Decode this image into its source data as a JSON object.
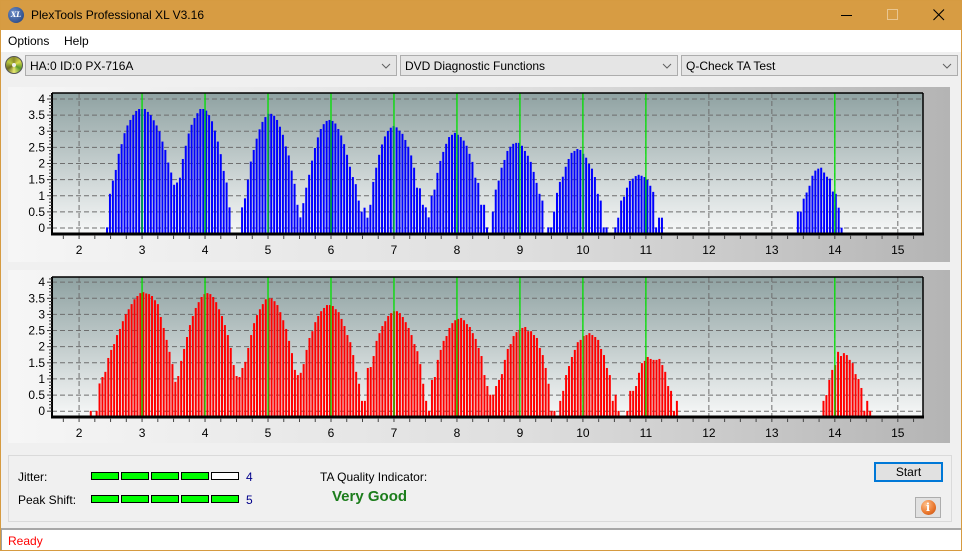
{
  "window": {
    "title": "PlexTools Professional XL V3.16",
    "app_logo_text": "XL",
    "icons": {
      "app": "xl-logo-icon",
      "minimize": "minimize-icon",
      "maximize": "maximize-icon",
      "close": "close-icon"
    },
    "frame_color": "#d79c43"
  },
  "menu": {
    "items": [
      {
        "label": "Options"
      },
      {
        "label": "Help"
      }
    ]
  },
  "toolbar": {
    "drive_icon": "cd-drive-icon",
    "drive_select": {
      "value": "HA:0 ID:0  PX-716A"
    },
    "function_select": {
      "value": "DVD Diagnostic Functions"
    },
    "test_select": {
      "value": "Q-Check TA Test"
    }
  },
  "results": {
    "jitter": {
      "label": "Jitter:",
      "value": "4",
      "level": 4,
      "max": 5
    },
    "peak_shift": {
      "label": "Peak Shift:",
      "value": "5",
      "level": 5,
      "max": 5
    },
    "ta_quality": {
      "label": "TA Quality Indicator:",
      "value": "Very Good",
      "color": "#1c7d1c"
    },
    "meter_on_color": "#00ff00"
  },
  "buttons": {
    "start": "Start",
    "info_icon": "info-icon",
    "info_glyph": "i"
  },
  "status": {
    "text": "Ready",
    "color": "#ff0000"
  },
  "chart_data": [
    {
      "type": "bar",
      "title": "",
      "xlabel": "",
      "ylabel": "",
      "xlim": [
        1.57,
        15.4
      ],
      "ylim": [
        -0.186,
        4.186
      ],
      "xticks": [
        2,
        3,
        4,
        5,
        6,
        7,
        8,
        9,
        10,
        11,
        12,
        13,
        14,
        15
      ],
      "yticks": [
        "0",
        "0.5",
        "1",
        "1.5",
        "2",
        "2.5",
        "3",
        "3.5",
        "4"
      ],
      "grid": true,
      "legend": "none",
      "bar_color": "#0000ff",
      "marker_color": "#00e000",
      "plot_bg": [
        "#8fa2a2",
        "#f7f8f8"
      ],
      "markers": [
        3,
        4,
        5,
        6,
        7,
        8,
        9,
        10,
        11,
        14
      ],
      "bar_step": 0.0463,
      "runs": [
        {
          "start": 2.444,
          "values": [
            0.02,
            1.06,
            1.47,
            1.8,
            2.3,
            2.6,
            2.94,
            3.18,
            3.35,
            3.5,
            3.63,
            3.69,
            3.69,
            3.69,
            3.6,
            3.5,
            3.34,
            3.18,
            3.0,
            2.68,
            2.42,
            2.03,
            1.72,
            1.34,
            1.41,
            1.56,
            2.14,
            2.55,
            2.93,
            3.2,
            3.41,
            3.56,
            3.69,
            3.69,
            3.64,
            3.5,
            3.31,
            3.02,
            2.68,
            2.29,
            1.77,
            1.41,
            0.64
          ]
        },
        {
          "start": 4.588,
          "values": [
            0.64,
            0.92,
            1.5,
            2.06,
            2.42,
            2.77,
            3.06,
            3.29,
            3.44,
            3.54,
            3.54,
            3.48,
            3.35,
            3.14,
            2.89,
            2.53,
            2.25,
            1.78,
            1.37,
            0.72,
            0.33,
            0.77,
            1.25,
            1.65,
            2.09,
            2.48,
            2.81,
            3.07,
            3.22,
            3.32,
            3.35,
            3.32,
            3.24,
            3.07,
            2.87,
            2.6,
            2.27,
            1.9,
            1.58,
            1.36,
            0.85,
            0.51,
            0.63,
            0.32,
            0.72,
            1.43,
            1.87,
            2.27,
            2.59,
            2.84,
            3.01,
            3.11,
            3.16,
            3.12,
            3.02,
            2.92,
            2.73,
            2.52,
            2.25,
            1.87,
            1.25,
            1.23,
            0.72,
            0.64,
            0.33,
            1.0,
            1.19,
            1.71,
            2.08,
            2.36,
            2.61,
            2.82,
            2.89,
            2.95,
            2.89,
            2.82,
            2.71,
            2.55,
            2.3,
            2.05,
            1.56,
            1.4,
            0.72,
            0.72,
            0.02,
            0,
            0.51,
            1.19,
            1.47,
            1.87,
            2.11,
            2.39,
            2.52,
            2.61,
            2.64,
            2.64,
            2.55,
            2.39,
            2.24,
            2.05,
            1.74,
            1.4,
            1.06,
            0.85,
            0,
            0.02,
            0.02,
            0.51,
            1.09,
            1.43,
            1.59,
            1.9,
            2.14,
            2.33,
            2.39,
            2.45,
            2.42,
            2.3,
            2.18,
            1.99,
            1.84,
            1.58,
            1.06,
            0.85,
            0.02,
            0.02,
            0,
            0,
            0.02,
            0.32,
            0.85,
            0.97,
            1.25,
            1.46,
            1.53,
            1.61,
            1.65,
            1.62,
            1.58,
            1.49,
            1.31,
            1.12,
            0.02,
            0.32,
            0.32
          ]
        },
        {
          "start": 13.413,
          "values": [
            0.51,
            0.51,
            0.91,
            1.1,
            1.31,
            1.62,
            1.78,
            1.84,
            1.87,
            1.72,
            1.59,
            1.53,
            1.13,
            1.06,
            0.63,
            0.01
          ]
        }
      ]
    },
    {
      "type": "bar",
      "title": "",
      "xlabel": "",
      "ylabel": "",
      "xlim": [
        1.57,
        15.4
      ],
      "ylim": [
        -0.18,
        4.16
      ],
      "xticks": [
        2,
        3,
        4,
        5,
        6,
        7,
        8,
        9,
        10,
        11,
        12,
        13,
        14,
        15
      ],
      "yticks": [
        "0",
        "0.5",
        "1",
        "1.5",
        "2",
        "2.5",
        "3",
        "3.5",
        "4"
      ],
      "grid": true,
      "legend": "none",
      "bar_color": "#ff0000",
      "marker_color": "#00e000",
      "plot_bg": [
        "#8fa2a2",
        "#f7f8f8"
      ],
      "markers": [
        3,
        4,
        5,
        6,
        7,
        8,
        9,
        10,
        11,
        14
      ],
      "bar_step": 0.0463,
      "runs": [
        {
          "start": 2.186,
          "values": [
            0.01,
            0,
            0.01,
            0.86,
            1.06,
            1.22,
            1.65,
            1.9,
            2.08,
            2.36,
            2.55,
            2.79,
            3.01,
            3.16,
            3.32,
            3.47,
            3.57,
            3.66,
            3.69,
            3.65,
            3.63,
            3.57,
            3.44,
            3.32,
            2.92,
            2.58,
            2.21,
            1.84,
            1.46,
            0.91,
            1.09,
            1.56,
            1.93,
            2.3,
            2.67,
            2.95,
            3.2,
            3.38,
            3.54,
            3.63,
            3.66,
            3.63,
            3.54,
            3.38,
            3.16,
            2.95,
            2.67,
            2.36,
            1.96,
            1.43,
            1.09,
            1.06,
            1.34,
            1.53,
            1.96,
            2.36,
            2.73,
            2.98,
            3.16,
            3.32,
            3.47,
            3.5,
            3.5,
            3.41,
            3.29,
            3.07,
            2.82,
            2.55,
            2.18,
            1.8,
            1.28,
            1.12,
            1.19,
            1.46,
            1.9,
            2.27,
            2.48,
            2.76,
            2.95,
            3.1,
            3.2,
            3.29,
            3.29,
            3.26,
            3.16,
            3.07,
            2.86,
            2.64,
            2.36,
            2.14,
            1.74,
            1.22,
            0.85,
            0.32,
            0.32,
            1.34,
            1.37,
            1.71,
            2.18,
            2.42,
            2.64,
            2.79,
            2.95,
            3.04,
            3.1,
            3.1,
            3.04,
            2.92,
            2.76,
            2.58,
            2.36,
            2.08,
            1.86,
            1.46,
            0.85,
            0.32,
            0.01,
            0.97,
            1.06,
            1.59,
            1.9,
            2.18,
            2.33,
            2.58,
            2.73,
            2.82,
            2.86,
            2.89,
            2.82,
            2.7,
            2.61,
            2.42,
            2.24,
            1.96,
            1.71,
            1.12,
            0.78,
            0.51,
            0.51,
            0.78,
            0.97,
            1.15,
            1.59,
            1.93,
            2.08,
            2.33,
            2.45,
            2.52,
            2.58,
            2.61,
            2.48,
            2.48,
            2.36,
            2.27,
            1.96,
            1.74,
            1.34,
            0.85,
            0.01,
            0.01,
            0,
            0.32,
            0.63,
            1.12,
            1.4,
            1.68,
            1.9,
            2.14,
            2.21,
            2.33,
            2.36,
            2.42,
            2.36,
            2.3,
            2.21,
            1.93,
            1.74,
            1.34,
            1.12,
            0.32,
            0.51,
            0.01,
            0,
            0,
            0.01,
            0.63,
            0.63,
            0.78,
            1.19,
            1.49,
            1.56,
            1.68,
            1.62,
            1.59,
            1.59,
            1.62,
            1.43,
            1.22,
            0.78,
            0.63,
            0.01,
            0.32
          ]
        },
        {
          "start": 13.82,
          "values": [
            0.32,
            0.5,
            0.97,
            1.28,
            1.43,
            1.84,
            1.71,
            1.8,
            1.74,
            1.59,
            1.49,
            1.15,
            1.0,
            0.72,
            0.01,
            0.32,
            0.01
          ]
        }
      ]
    }
  ]
}
